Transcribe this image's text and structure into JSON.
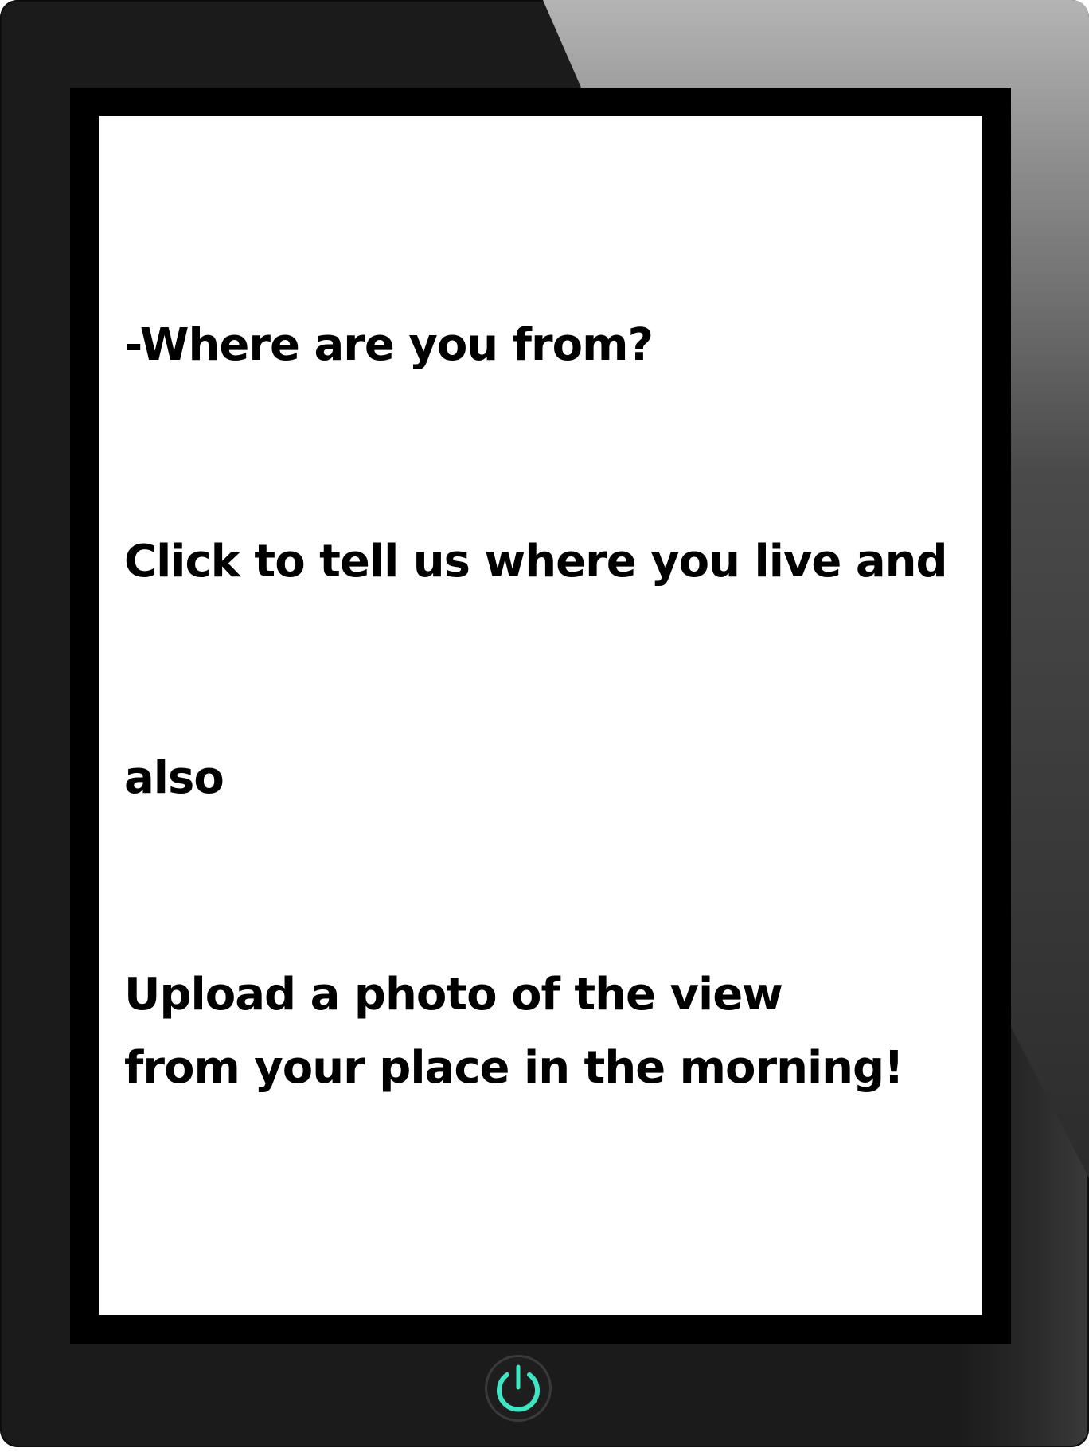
{
  "screen": {
    "lines": [
      "-Where are you from?",
      "Click to tell us where you live and",
      "also",
      "Upload a photo of the view",
      "from your place in the morning!"
    ]
  },
  "device": {
    "power_icon": "power-icon",
    "power_icon_color": "#3ee6c4",
    "bezel_color": "#000000",
    "frame_color": "#1b1b1b"
  }
}
